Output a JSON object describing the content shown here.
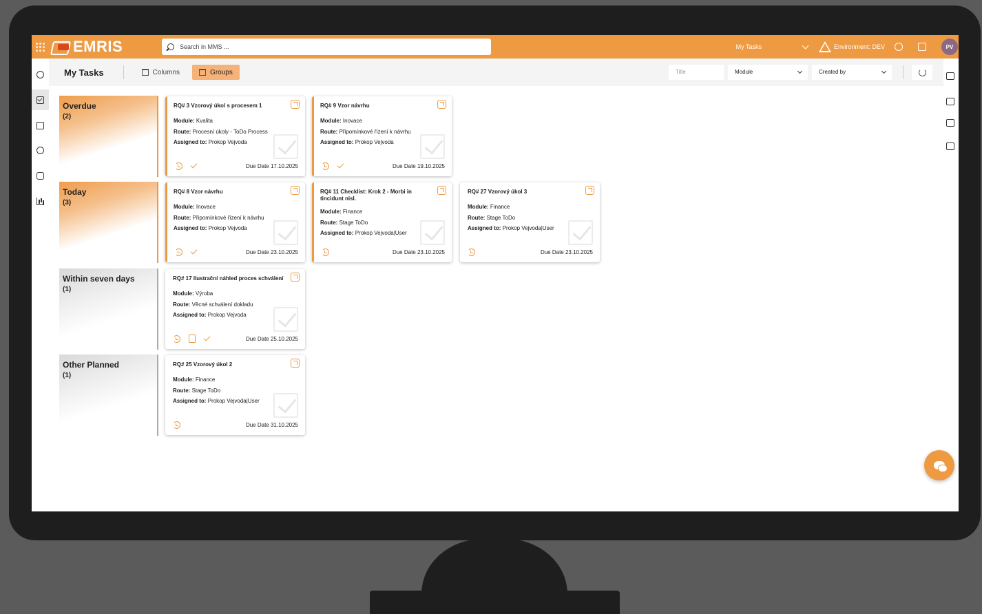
{
  "app": {
    "name": "EMRIS",
    "search_placeholder": "Search in MMS ...",
    "current_page_link": "My Tasks",
    "environment": "Environment: DEV",
    "user_initials": "PV"
  },
  "toolbar": {
    "title": "My Tasks",
    "columns_label": "Columns",
    "groups_label": "Groups",
    "filter_title_placeholder": "Title",
    "filter_module": "Module",
    "filter_created_by": "Created by"
  },
  "groups": [
    {
      "name": "Overdue",
      "count": "(2)"
    },
    {
      "name": "Today",
      "count": "(3)"
    },
    {
      "name": "Within seven days",
      "count": "(1)"
    },
    {
      "name": "Other Planned",
      "count": "(1)"
    }
  ],
  "labels": {
    "module": "Module:",
    "route": "Route:",
    "assigned": "Assigned to:"
  },
  "cards": [
    {
      "title": "RQ# 3 Vzorový úkol s procesem 1",
      "module": "Kvalita",
      "route": "Procesní úkoly - ToDo Process",
      "assigned": "Prokop Vejvoda",
      "due": "Due Date 17.10.2025"
    },
    {
      "title": "RQ# 9 Vzor návrhu",
      "module": "Inovace",
      "route": "Připomínkové řízení k návrhu",
      "assigned": "Prokop Vejvoda",
      "due": "Due Date 19.10.2025"
    },
    {
      "title": "RQ# 8 Vzor návrhu",
      "module": "Inovace",
      "route": "Připomínkové řízení k návrhu",
      "assigned": "Prokop Vejvoda",
      "due": "Due Date 23.10.2025"
    },
    {
      "title": "RQ# 11 Checklist: Krok 2 - Morbi in tincidunt nisl.",
      "module": "Finance",
      "route": "Stage ToDo",
      "assigned": "Prokop Vejvoda|User",
      "due": "Due Date 23.10.2025"
    },
    {
      "title": "RQ# 27 Vzorový úkol 3",
      "module": "Finance",
      "route": "Stage ToDo",
      "assigned": "Prokop Vejvoda|User",
      "due": "Due Date 23.10.2025"
    },
    {
      "title": "RQ# 17 Ilustrační náhled proces schválení",
      "module": "Výroba",
      "route": "Věcné schválení dokladu",
      "assigned": "Prokop Vejvoda",
      "due": "Due Date 25.10.2025"
    },
    {
      "title": "RQ# 25 Vzorový úkol 2",
      "module": "Finance",
      "route": "Stage ToDo",
      "assigned": "Prokop Vejvoda|User",
      "due": "Due Date 31.10.2025"
    }
  ],
  "colors": {
    "accent": "#ee9a43",
    "active_button": "#f5b37a",
    "frame": "#1e1e1e"
  }
}
